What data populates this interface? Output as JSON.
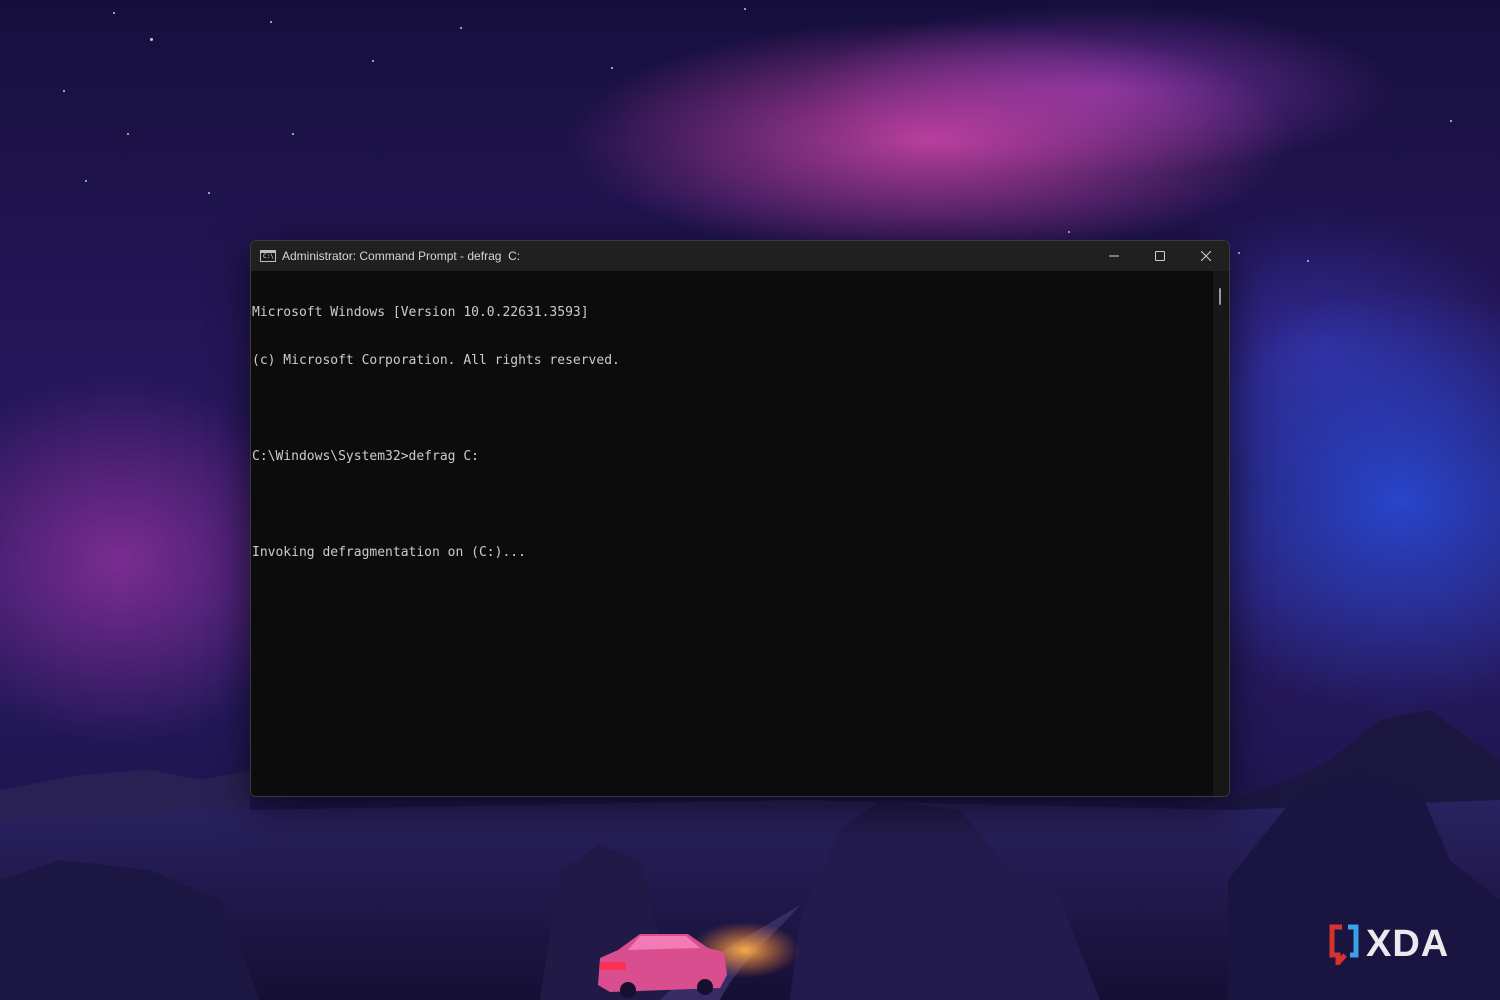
{
  "window": {
    "title": "Administrator: Command Prompt - defrag  C:",
    "icon": "cmd-icon",
    "icon_text": "C:\\",
    "controls": {
      "minimize": "minimize-icon",
      "maximize": "maximize-icon",
      "close": "close-icon"
    }
  },
  "console": {
    "lines": [
      "Microsoft Windows [Version 10.0.22631.3593]",
      "(c) Microsoft Corporation. All rights reserved.",
      "",
      "C:\\Windows\\System32>defrag C:",
      "",
      "Invoking defragmentation on (C:)..."
    ],
    "text_color": "#cccccc",
    "background_color": "#0c0c0c"
  },
  "colors": {
    "title_bar": "#202020",
    "close_hover": "#c42b1c"
  },
  "watermark": {
    "logo_text": "XDA",
    "logo_accent": "#d6322e"
  }
}
